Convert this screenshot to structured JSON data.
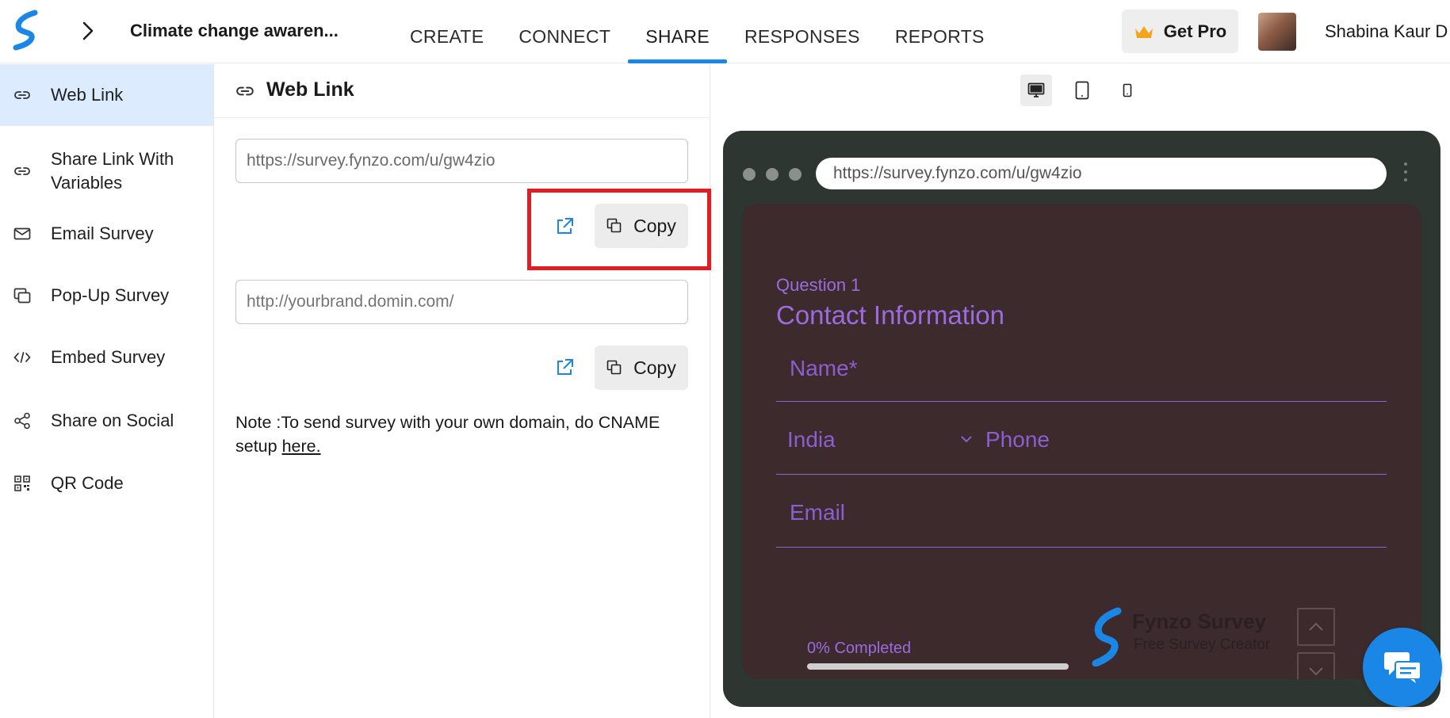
{
  "header": {
    "survey_title": "Climate change awaren...",
    "tabs": [
      {
        "label": "CREATE",
        "active": false
      },
      {
        "label": "CONNECT",
        "active": false
      },
      {
        "label": "SHARE",
        "active": true
      },
      {
        "label": "RESPONSES",
        "active": false
      },
      {
        "label": "REPORTS",
        "active": false
      }
    ],
    "get_pro_label": "Get Pro",
    "user_name": "Shabina Kaur D"
  },
  "sidebar": {
    "items": [
      {
        "label": "Web Link",
        "icon": "link-icon",
        "active": true
      },
      {
        "label": "Share Link With Variables",
        "icon": "link-icon",
        "active": false
      },
      {
        "label": "Email Survey",
        "icon": "mail-icon",
        "active": false
      },
      {
        "label": "Pop-Up Survey",
        "icon": "popup-icon",
        "active": false
      },
      {
        "label": "Embed Survey",
        "icon": "code-icon",
        "active": false
      },
      {
        "label": "Share on Social",
        "icon": "share-icon",
        "active": false
      },
      {
        "label": "QR Code",
        "icon": "qr-code-icon",
        "active": false
      }
    ]
  },
  "panel": {
    "title": "Web Link",
    "survey_url": "https://survey.fynzo.com/u/gw4zio",
    "custom_domain_placeholder": "http://yourbrand.domin.com/",
    "copy_label": "Copy",
    "note_text": "Note :To send survey with your own domain, do CNAME setup ",
    "note_link": "here."
  },
  "preview": {
    "address": "https://survey.fynzo.com/u/gw4zio",
    "question_number": "Question 1",
    "question_title": "Contact Information",
    "name_placeholder": "Name*",
    "country": "India",
    "phone_placeholder": "Phone",
    "email_placeholder": "Email",
    "progress_label": "0% Completed",
    "progress_fraction": 0,
    "brand_name": "Fynzo Survey",
    "brand_tagline": "Free Survey Creator"
  },
  "colors": {
    "accent": "#1a87e6",
    "highlight_box": "#e31b23",
    "preview_frame": "#2e3631",
    "form_background": "#3d2a2c",
    "form_text": "#9b6bdf"
  }
}
